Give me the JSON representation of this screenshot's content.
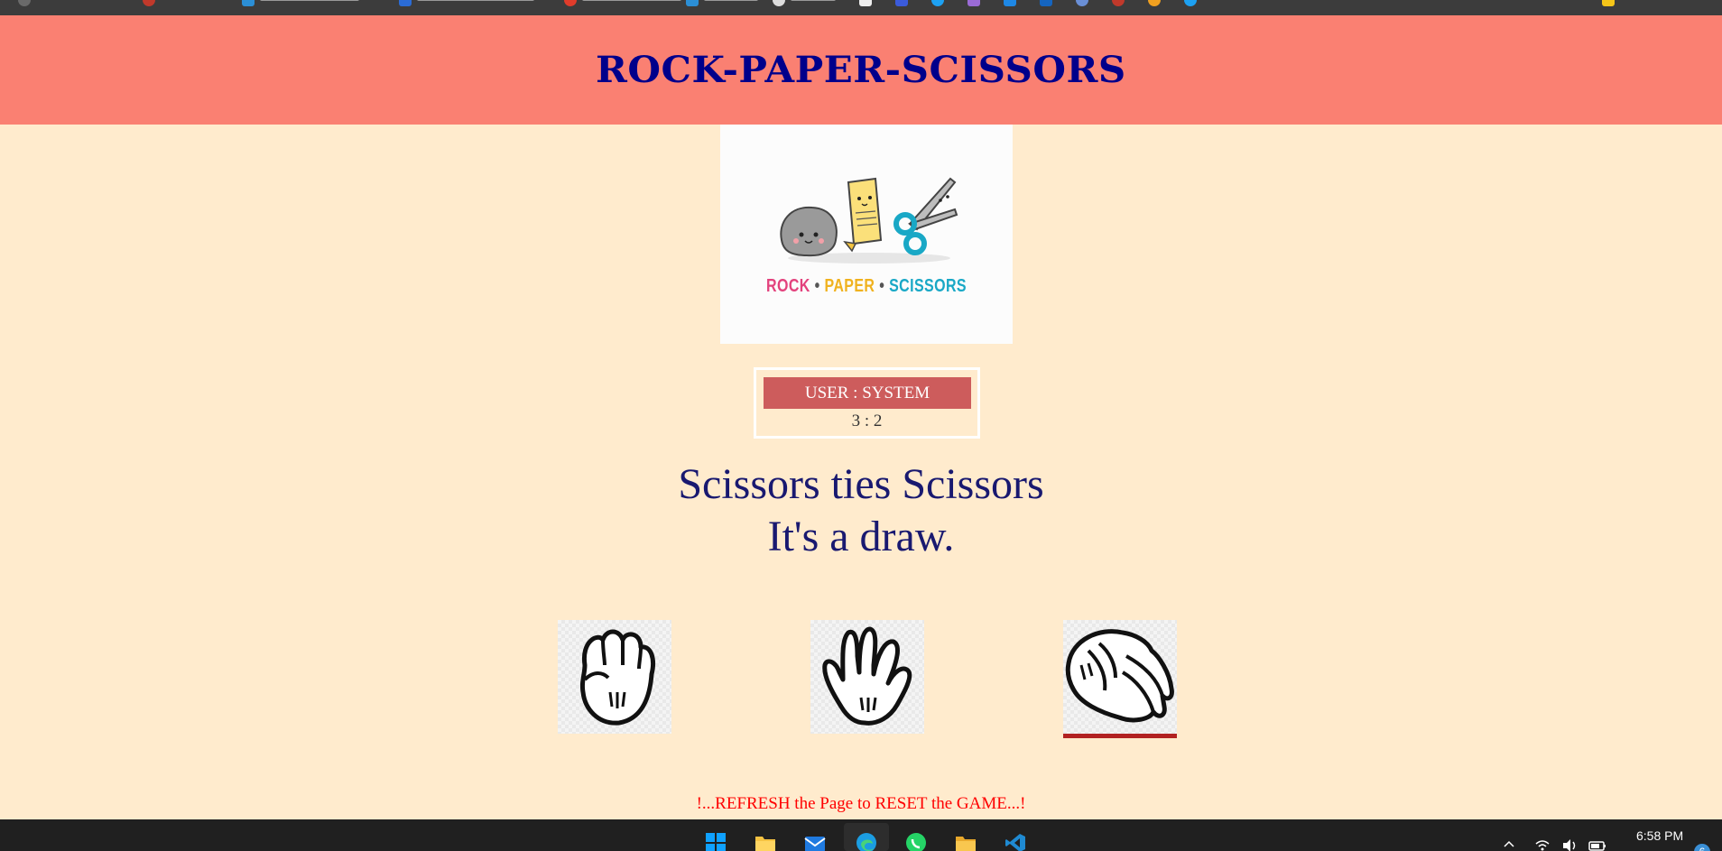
{
  "header": {
    "title": "ROCK-PAPER-SCISSORS"
  },
  "logo": {
    "rock": "ROCK",
    "paper": "PAPER",
    "scissors": "SCISSORS",
    "separator": "•"
  },
  "scoreboard": {
    "label": "USER : SYSTEM",
    "score": "3 : 2"
  },
  "result": {
    "line1": "Scissors ties Scissors",
    "line2": "It's a draw."
  },
  "choices": [
    {
      "id": "rock",
      "icon": "fist-glove-icon",
      "selected": false
    },
    {
      "id": "paper",
      "icon": "open-hand-glove-icon",
      "selected": false
    },
    {
      "id": "scissors",
      "icon": "scissors-hand-glove-icon",
      "selected": true
    }
  ],
  "footer": {
    "note": "!...REFRESH the Page to RESET the GAME...!"
  },
  "taskbar": {
    "time": "6:58 PM",
    "date": "",
    "notification_count": "6",
    "icons": [
      "windows-start-icon",
      "file-explorer-icon",
      "mail-icon",
      "edge-browser-icon",
      "whatsapp-icon",
      "folder-icon",
      "vscode-icon"
    ]
  },
  "colors": {
    "background": "#ffebcd",
    "header": "#fa8072",
    "title": "#00008b",
    "score_head": "#cd5c5c",
    "result_text": "#191970",
    "selected_underline": "#b22222",
    "reset_note": "#ff0000"
  }
}
